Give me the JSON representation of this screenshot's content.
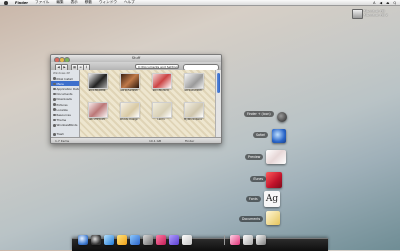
{
  "menubar": {
    "app_name": "Finder",
    "items": [
      "ファイル",
      "編集",
      "表示",
      "移動",
      "ウィンドウ",
      "ヘルプ"
    ],
    "right_items": [
      "A",
      "◀",
      "⏏",
      "Q"
    ]
  },
  "disk_widget": {
    "line1": "Macintosh HD",
    "line2": "Macintosh HD 2"
  },
  "finder": {
    "title": "Stuff",
    "path": "C:\\Documents and Settings",
    "sidebar": {
      "header": "Windows XP",
      "items": [
        "iDisk Install",
        "Menu",
        "Application Data",
        "Documents",
        "Downloads",
        "Pictures",
        "Localize",
        "Resources",
        "Theme",
        "WindowsBlinds"
      ],
      "selected": "Menu",
      "trash": "Trash"
    },
    "files": [
      {
        "name": "a0r1f6b0889"
      },
      {
        "name": "a0r1b5a3998"
      },
      {
        "name": "a0r1f0x3b3c"
      },
      {
        "name": "a0r1a4v0908"
      },
      {
        "name": "a0r1f3f3005"
      },
      {
        "name": "Woods Design"
      },
      {
        "name": "Lani's"
      },
      {
        "name": "MyWorkspace"
      }
    ],
    "status": {
      "left": "1.7 items",
      "mid": "10.1 GB",
      "right": "Finder"
    }
  },
  "stack": [
    {
      "label": "Finder + (icon)"
    },
    {
      "label": "Safari"
    },
    {
      "label": "Preview"
    },
    {
      "label": "iTunes"
    },
    {
      "label": "Fonts"
    },
    {
      "label": "Documents"
    }
  ]
}
